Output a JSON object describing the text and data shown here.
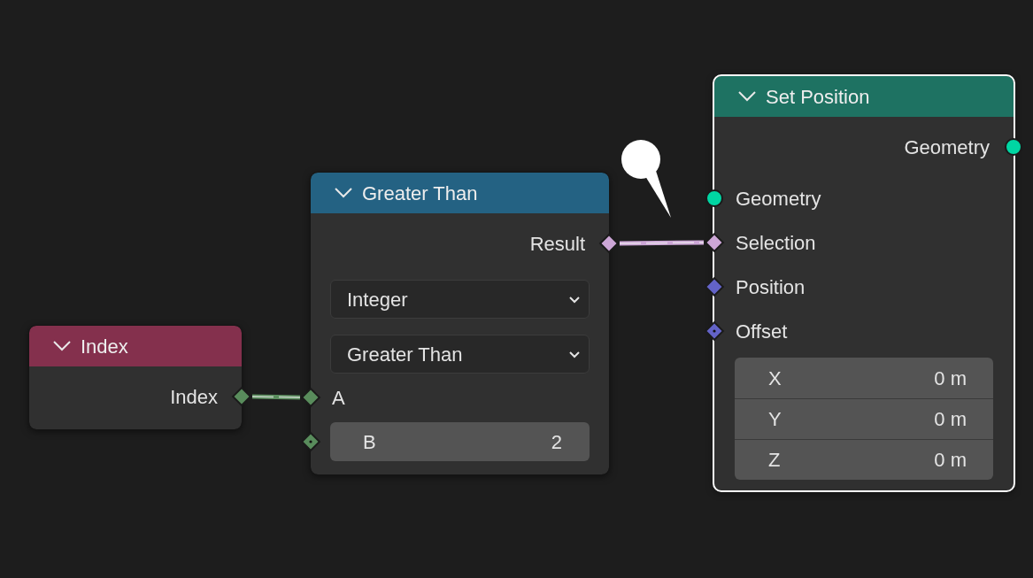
{
  "nodes": [
    {
      "title": "Index",
      "color": "#84304d",
      "selected": false,
      "rows": [
        {
          "kind": "output",
          "label": "Index",
          "socket": {
            "kind": "diamond",
            "color": "#598c5c"
          }
        }
      ]
    },
    {
      "title": "Greater Than",
      "color": "#246283",
      "selected": false,
      "rows": [
        {
          "kind": "output",
          "label": "Result",
          "socket": {
            "kind": "diamond",
            "color": "#cca6d6"
          }
        },
        {
          "kind": "dropdown",
          "value": "Integer"
        },
        {
          "kind": "dropdown",
          "value": "Greater Than"
        },
        {
          "kind": "input",
          "label": "A",
          "socket": {
            "kind": "diamond",
            "color": "#598c5c"
          }
        },
        {
          "kind": "number",
          "label": "B",
          "value": "2",
          "socket": {
            "kind": "diamond-dot",
            "color": "#598c5c"
          }
        }
      ]
    },
    {
      "title": "Set Position",
      "color": "#1e7262",
      "selected": true,
      "rows": [
        {
          "kind": "output",
          "label": "Geometry",
          "socket": {
            "kind": "circle",
            "color": "#00d6a3"
          }
        },
        {
          "kind": "input",
          "label": "Geometry",
          "socket": {
            "kind": "circle",
            "color": "#00d6a3"
          }
        },
        {
          "kind": "input",
          "label": "Selection",
          "socket": {
            "kind": "diamond",
            "color": "#cca6d6"
          }
        },
        {
          "kind": "input",
          "label": "Position",
          "socket": {
            "kind": "diamond",
            "color": "#6363c7"
          }
        },
        {
          "kind": "input",
          "label": "Offset",
          "socket": {
            "kind": "diamond-dot",
            "color": "#6363c7"
          }
        },
        {
          "kind": "vector",
          "components": [
            {
              "label": "X",
              "value": "0 m"
            },
            {
              "label": "Y",
              "value": "0 m"
            },
            {
              "label": "Z",
              "value": "0 m"
            }
          ]
        }
      ]
    }
  ]
}
